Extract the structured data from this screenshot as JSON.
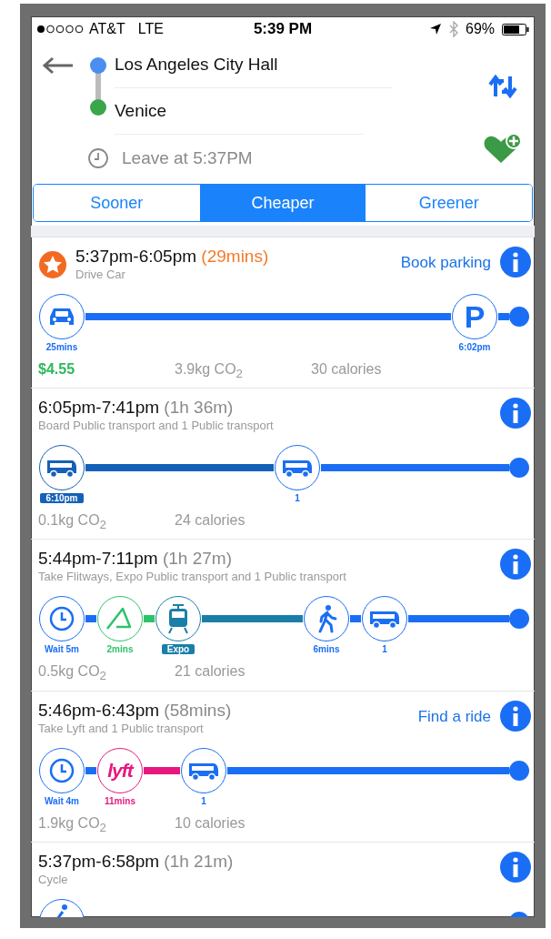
{
  "status_bar": {
    "carrier": "AT&T",
    "network": "LTE",
    "time": "5:39 PM",
    "battery": "69%"
  },
  "route": {
    "from": "Los Angeles City Hall",
    "to": "Venice",
    "leave": "Leave at 5:37PM"
  },
  "tabs": [
    {
      "label": "Sooner",
      "selected": false
    },
    {
      "label": "Cheaper",
      "selected": true
    },
    {
      "label": "Greener",
      "selected": false
    }
  ],
  "trips": [
    {
      "time": "5:37pm-6:05pm",
      "duration": "(29mins)",
      "featured": true,
      "description": "Drive Car",
      "action": "Book parking",
      "cost": "$4.55",
      "co2": "3.9kg CO$_{2}$",
      "calories": "30 calories",
      "legs": [
        {
          "kind": "car",
          "label": "25mins",
          "badge": false,
          "color": "#1a6ef5",
          "long": true
        },
        {
          "kind": "parking",
          "glyph": "P",
          "label": "6:02pm",
          "badge": false,
          "color": "#1a6ef5",
          "long": false
        }
      ]
    },
    {
      "time": "6:05pm-7:41pm",
      "duration": "(1h 36m)",
      "featured": false,
      "description": "Board Public transport and 1 Public transport",
      "co2": "0.1kg CO$_{2}$",
      "calories": "24 calories",
      "legs": [
        {
          "kind": "bus",
          "label": "6:10pm",
          "badge": true,
          "color": "#1560b8",
          "long": true
        },
        {
          "kind": "bus",
          "label": "1",
          "badge": false,
          "color": "#1a6ef5",
          "long": true
        }
      ]
    },
    {
      "time": "5:44pm-7:11pm",
      "duration": "(1h 27m)",
      "featured": false,
      "description": "Take Flitways, Expo Public transport and 1 Public transport",
      "co2": "0.5kg CO$_{2}$",
      "calories": "21 calories",
      "legs": [
        {
          "kind": "wait",
          "label": "Wait 5m",
          "badge": false,
          "color": "#1a6ef5",
          "long": false
        },
        {
          "kind": "flitways",
          "label": "2mins",
          "badge": false,
          "color": "#2ec36a",
          "long": false
        },
        {
          "kind": "tram",
          "label": "Expo",
          "badge": true,
          "color": "#1a7fa8",
          "long": true
        },
        {
          "kind": "walk",
          "label": "6mins",
          "badge": false,
          "color": "#1a6ef5",
          "long": false
        },
        {
          "kind": "bus",
          "label": "1",
          "badge": false,
          "color": "#1a6ef5",
          "long": true
        }
      ]
    },
    {
      "time": "5:46pm-6:43pm",
      "duration": "(58mins)",
      "featured": false,
      "description": "Take Lyft and 1 Public transport",
      "action": "Find a ride",
      "co2": "1.9kg CO$_{2}$",
      "calories": "10 calories",
      "legs": [
        {
          "kind": "wait",
          "label": "Wait 4m",
          "badge": false,
          "color": "#1a6ef5",
          "long": false
        },
        {
          "kind": "lyft",
          "glyph": "lyft",
          "label": "11mins",
          "badge": false,
          "color": "#e6177f",
          "long": false
        },
        {
          "kind": "bus",
          "label": "1",
          "badge": false,
          "color": "#1a6ef5",
          "long": true
        }
      ]
    },
    {
      "time": "5:37pm-6:58pm",
      "duration": "(1h 21m)",
      "featured": false,
      "description": "Cycle",
      "legs": [
        {
          "kind": "bike",
          "color": "#1a6ef5"
        }
      ]
    }
  ]
}
